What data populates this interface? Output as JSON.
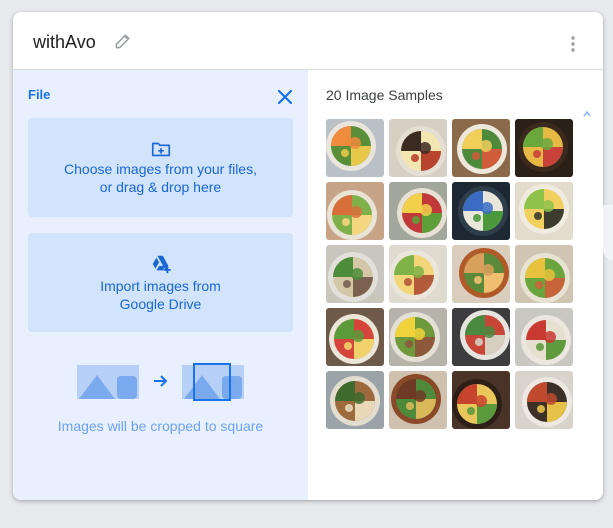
{
  "header": {
    "title": "withAvo",
    "edit_icon": "pencil-icon",
    "menu_icon": "more-vert-icon"
  },
  "upload_panel": {
    "heading": "File",
    "close_icon": "close-icon",
    "local_upload": {
      "line1": "Choose images from your files,",
      "line2": "or drag & drop here",
      "icon": "folder-add-icon"
    },
    "drive_import": {
      "line1": "Import images from",
      "line2": "Google Drive",
      "icon": "google-drive-add-icon"
    },
    "crop_note": "Images will be cropped to square"
  },
  "samples_panel": {
    "title": "20 Image Samples",
    "thumbnails": [
      {
        "plate": "#e9e4dc",
        "bg": "#b9c1c6",
        "a": "#f08a3c",
        "b": "#5a8f3a",
        "c": "#e8c84a"
      },
      {
        "plate": "#e5ded2",
        "bg": "#d6cfc4",
        "a": "#3b2a22",
        "b": "#f3e6b0",
        "c": "#b8442e"
      },
      {
        "plate": "#eee8dc",
        "bg": "#8a6a4a",
        "a": "#f2cf5a",
        "b": "#4d8a3b",
        "c": "#cf5c3a"
      },
      {
        "plate": "#3a2a1e",
        "bg": "#2a2018",
        "a": "#6aa83e",
        "b": "#e6b844",
        "c": "#c9423a"
      },
      {
        "plate": "#e9e3d6",
        "bg": "#c7a488",
        "a": "#d86e3a",
        "b": "#7fb04a",
        "c": "#f4d580"
      },
      {
        "plate": "#e6e1d4",
        "bg": "#a3a69a",
        "a": "#f2d04a",
        "b": "#c0393a",
        "c": "#5f9f3a"
      },
      {
        "plate": "#2e3d4a",
        "bg": "#1d2833",
        "a": "#3a6cc4",
        "b": "#e9e6dc",
        "c": "#4a9a3c"
      },
      {
        "plate": "#f0ebe0",
        "bg": "#e3dccd",
        "a": "#8ec24a",
        "b": "#f2d060",
        "c": "#3b3b30"
      },
      {
        "plate": "#e2e0da",
        "bg": "#c8c6bd",
        "a": "#4c8c3a",
        "b": "#d4c7a8",
        "c": "#7a6150"
      },
      {
        "plate": "#eae6dc",
        "bg": "#e0dbd0",
        "a": "#7fb347",
        "b": "#f3d57a",
        "c": "#b35a3a"
      },
      {
        "plate": "#b05a2a",
        "bg": "#d9cdbd",
        "a": "#d8a05a",
        "b": "#5a8a3a",
        "c": "#f0c070"
      },
      {
        "plate": "#e8e2d2",
        "bg": "#cfc5b2",
        "a": "#e8c23c",
        "b": "#6aa43c",
        "c": "#c8643a"
      },
      {
        "plate": "#ece6d8",
        "bg": "#6e5a48",
        "a": "#5b9a3a",
        "b": "#d6453c",
        "c": "#f1d26a"
      },
      {
        "plate": "#e4e0d6",
        "bg": "#b6b3aa",
        "a": "#f0d23a",
        "b": "#6e9a3c",
        "c": "#8c5a3a"
      },
      {
        "plate": "#e6e4de",
        "bg": "#3d3d40",
        "a": "#4a8a3e",
        "b": "#c84638",
        "c": "#d6cfc0"
      },
      {
        "plate": "#ebe7e0",
        "bg": "#c9c7c2",
        "a": "#c83a32",
        "b": "#e6e0d0",
        "c": "#5f9a3e"
      },
      {
        "plate": "#e3ddd0",
        "bg": "#9aa3a8",
        "a": "#3e6a2e",
        "b": "#9c6a3c",
        "c": "#e8d8b8"
      },
      {
        "plate": "#8a4a2a",
        "bg": "#cfc1ad",
        "a": "#6e3a26",
        "b": "#4f8a3a",
        "c": "#d9b85a"
      },
      {
        "plate": "#2e1e18",
        "bg": "#4a3428",
        "a": "#c8432e",
        "b": "#e9c65a",
        "c": "#5a9a3c"
      },
      {
        "plate": "#ede9e2",
        "bg": "#d9d4cb",
        "a": "#c04a2e",
        "b": "#3c3028",
        "c": "#e6c248"
      }
    ]
  },
  "colors": {
    "accent": "#1a73e8",
    "panel_bg": "#e8f0fe",
    "box_bg": "#d2e3fc",
    "text_blue": "#1967d2"
  }
}
